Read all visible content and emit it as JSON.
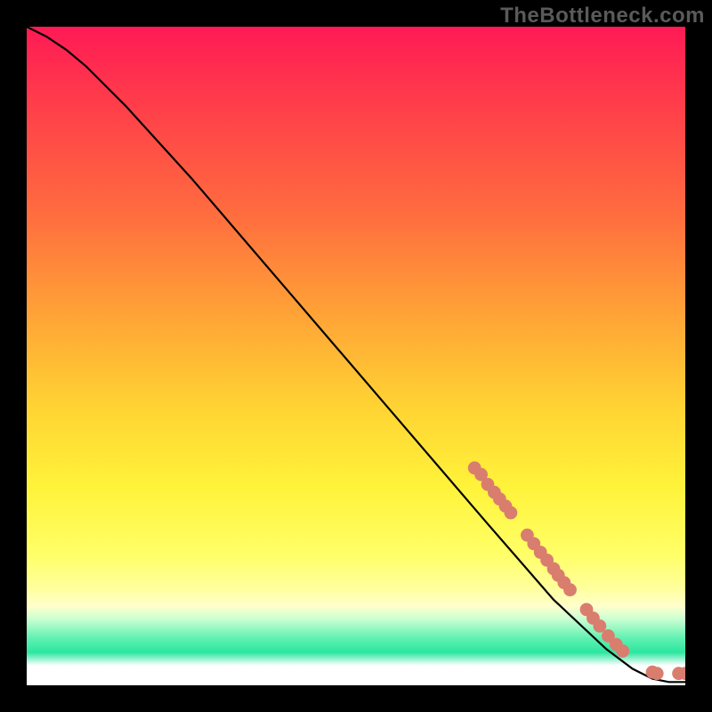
{
  "watermark": "TheBottleneck.com",
  "chart_data": {
    "type": "line",
    "title": "",
    "xlabel": "",
    "ylabel": "",
    "xlim": [
      0,
      1
    ],
    "ylim": [
      0,
      1
    ],
    "grid": false,
    "legend": false,
    "gradient_bands": [
      {
        "y_frac": 0.0,
        "color": "#ff1a55"
      },
      {
        "y_frac": 0.12,
        "color": "#ff3e4a"
      },
      {
        "y_frac": 0.28,
        "color": "#ff6b3f"
      },
      {
        "y_frac": 0.44,
        "color": "#ffa436"
      },
      {
        "y_frac": 0.58,
        "color": "#ffd433"
      },
      {
        "y_frac": 0.7,
        "color": "#fff33a"
      },
      {
        "y_frac": 0.8,
        "color": "#ffff66"
      },
      {
        "y_frac": 0.85,
        "color": "#ffff99"
      },
      {
        "y_frac": 0.88,
        "color": "#ffffcc"
      },
      {
        "y_frac": 0.9,
        "color": "#c8ffd1"
      },
      {
        "y_frac": 0.93,
        "color": "#5cf0b0"
      },
      {
        "y_frac": 0.95,
        "color": "#2ce6a0"
      },
      {
        "y_frac": 0.97,
        "color": "#ffffff"
      }
    ],
    "series": [
      {
        "name": "curve",
        "color": "#000000",
        "x": [
          0.0,
          0.03,
          0.06,
          0.09,
          0.15,
          0.25,
          0.4,
          0.55,
          0.7,
          0.8,
          0.88,
          0.92,
          0.95,
          0.975,
          1.0
        ],
        "y": [
          1.0,
          0.985,
          0.965,
          0.94,
          0.88,
          0.77,
          0.595,
          0.42,
          0.245,
          0.13,
          0.055,
          0.025,
          0.01,
          0.005,
          0.005
        ]
      }
    ],
    "markers": {
      "color": "#d97d6f",
      "radius_frac": 0.01,
      "points": [
        {
          "x": 0.68,
          "y": 0.33
        },
        {
          "x": 0.69,
          "y": 0.32
        },
        {
          "x": 0.7,
          "y": 0.305
        },
        {
          "x": 0.71,
          "y": 0.293
        },
        {
          "x": 0.718,
          "y": 0.283
        },
        {
          "x": 0.727,
          "y": 0.272
        },
        {
          "x": 0.735,
          "y": 0.262
        },
        {
          "x": 0.76,
          "y": 0.228
        },
        {
          "x": 0.77,
          "y": 0.215
        },
        {
          "x": 0.78,
          "y": 0.202
        },
        {
          "x": 0.79,
          "y": 0.19
        },
        {
          "x": 0.8,
          "y": 0.177
        },
        {
          "x": 0.807,
          "y": 0.167
        },
        {
          "x": 0.816,
          "y": 0.156
        },
        {
          "x": 0.825,
          "y": 0.145
        },
        {
          "x": 0.85,
          "y": 0.115
        },
        {
          "x": 0.86,
          "y": 0.102
        },
        {
          "x": 0.87,
          "y": 0.09
        },
        {
          "x": 0.883,
          "y": 0.075
        },
        {
          "x": 0.895,
          "y": 0.062
        },
        {
          "x": 0.905,
          "y": 0.052
        },
        {
          "x": 0.95,
          "y": 0.02
        },
        {
          "x": 0.957,
          "y": 0.018
        },
        {
          "x": 0.99,
          "y": 0.018
        },
        {
          "x": 1.0,
          "y": 0.018
        }
      ]
    }
  }
}
